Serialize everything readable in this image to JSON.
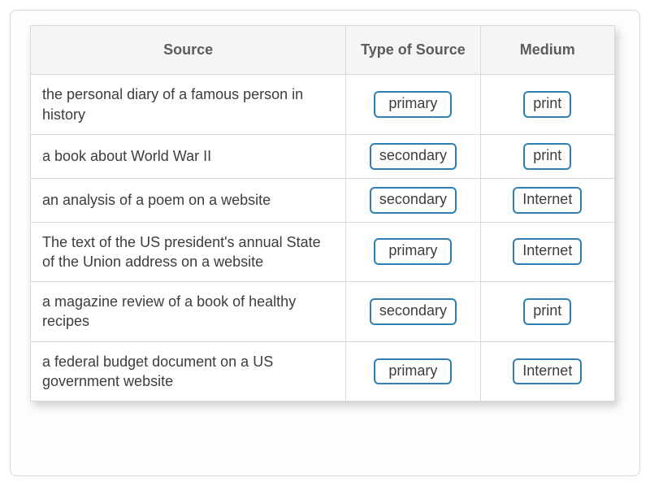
{
  "headers": {
    "source": "Source",
    "type": "Type of Source",
    "medium": "Medium"
  },
  "rows": [
    {
      "source": "the personal diary of a famous person in history",
      "type": "primary",
      "medium": "print"
    },
    {
      "source": "a book about World War II",
      "type": "secondary",
      "medium": "print"
    },
    {
      "source": "an analysis of a poem on a website",
      "type": "secondary",
      "medium": "Internet"
    },
    {
      "source": "The text of the US president's annual State of the Union address on a website",
      "type": "primary",
      "medium": "Internet"
    },
    {
      "source": "a magazine review of a book of healthy recipes",
      "type": "secondary",
      "medium": "print"
    },
    {
      "source": "a federal budget document on a US government website",
      "type": "primary",
      "medium": "Internet"
    }
  ],
  "chart_data": {
    "type": "table",
    "columns": [
      "Source",
      "Type of Source",
      "Medium"
    ],
    "data": [
      [
        "the personal diary of a famous person in history",
        "primary",
        "print"
      ],
      [
        "a book about World War II",
        "secondary",
        "print"
      ],
      [
        "an analysis of a poem on a website",
        "secondary",
        "Internet"
      ],
      [
        "The text of the US president's annual State of the Union address on a website",
        "primary",
        "Internet"
      ],
      [
        "a magazine review of a book of healthy recipes",
        "secondary",
        "print"
      ],
      [
        "a federal budget document on a US government website",
        "primary",
        "Internet"
      ]
    ]
  }
}
